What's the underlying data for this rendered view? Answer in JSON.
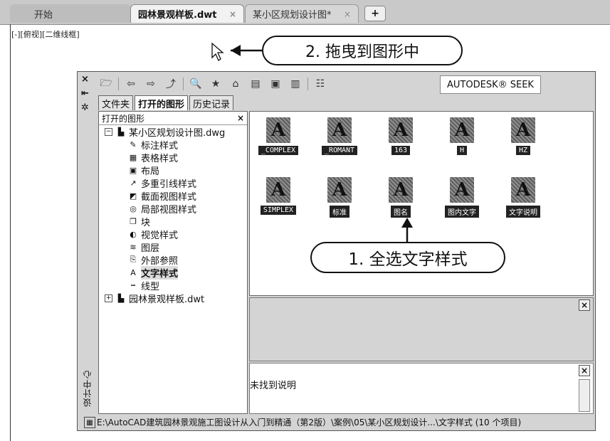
{
  "tabs": {
    "start": "开始",
    "active": "园林景观样板.dwt",
    "other": "某小区规划设计图*",
    "close": "×",
    "new": "+"
  },
  "viewport_label": "[-][俯视][二维线框]",
  "callouts": {
    "drag": "2. 拖曳到图形中",
    "select": "1. 全选文字样式"
  },
  "vertical_toolbar": [
    "×",
    "⇤",
    "✲"
  ],
  "vertical_title": "设计中心",
  "toolbar": {
    "icons": [
      "open-folder-icon",
      "back-icon",
      "forward-icon",
      "up-folder-icon",
      "search-icon",
      "favorites-icon",
      "home-icon",
      "tree-toggle-icon",
      "preview-icon",
      "description-icon",
      "views-icon"
    ],
    "seek": "AUTODESK® SEEK"
  },
  "panel_tabs": [
    "文件夹",
    "打开的图形",
    "历史记录"
  ],
  "tree": {
    "header": "打开的图形",
    "close": "×",
    "items": [
      {
        "label": "某小区规划设计图.dwg",
        "expander": "−",
        "indent": 0
      },
      {
        "label": "标注样式",
        "icon": "✎",
        "indent": 1
      },
      {
        "label": "表格样式",
        "icon": "▦",
        "indent": 1
      },
      {
        "label": "布局",
        "icon": "▣",
        "indent": 1
      },
      {
        "label": "多重引线样式",
        "icon": "↗",
        "indent": 1
      },
      {
        "label": "截面视图样式",
        "icon": "◩",
        "indent": 1
      },
      {
        "label": "局部视图样式",
        "icon": "◎",
        "indent": 1
      },
      {
        "label": "块",
        "icon": "❒",
        "indent": 1
      },
      {
        "label": "视觉样式",
        "icon": "◐",
        "indent": 1
      },
      {
        "label": "图层",
        "icon": "≋",
        "indent": 1
      },
      {
        "label": "外部参照",
        "icon": "⎘",
        "indent": 1
      },
      {
        "label": "文字样式",
        "icon": "A",
        "indent": 1,
        "selected": true
      },
      {
        "label": "线型",
        "icon": "┅",
        "indent": 1
      },
      {
        "label": "园林景观样板.dwt",
        "expander": "+",
        "indent": 0
      }
    ]
  },
  "text_styles": [
    "_COMPLEX",
    "_ROMANT",
    "163",
    "H",
    "HZ",
    "SIMPLEX",
    "标准",
    "图名",
    "图内文字",
    "文字说明"
  ],
  "description": "未找到说明",
  "status_path": "E:\\AutoCAD建筑园林景观施工图设计从入门到精通（第2版）\\案例\\05\\某小区规划设计...\\文字样式 (10 个项目)"
}
